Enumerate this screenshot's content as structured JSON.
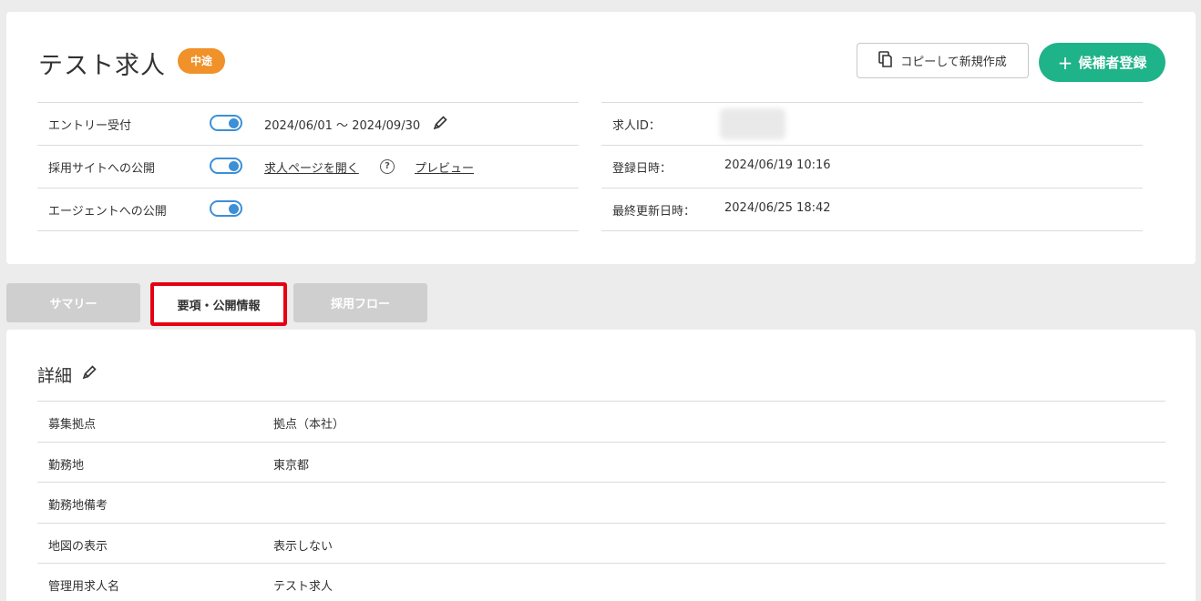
{
  "header": {
    "title": "テスト求人",
    "badge": "中途",
    "copy_button": "コピーして新規作成",
    "add_candidate_button": "候補者登録"
  },
  "status_left": [
    {
      "label": "エントリー受付",
      "toggle_on": true,
      "value": "2024/06/01 ～ 2024/09/30"
    },
    {
      "label": "採用サイトへの公開",
      "toggle_on": true,
      "link_open": "求人ページを開く",
      "help": "?",
      "link_preview": "プレビュー"
    },
    {
      "label": "エージェントへの公開",
      "toggle_on": true
    }
  ],
  "status_right": [
    {
      "label": "求人ID：",
      "value": ""
    },
    {
      "label": "登録日時：",
      "value": "2024/06/19 10:16"
    },
    {
      "label": "最終更新日時：",
      "value": "2024/06/25 18:42"
    }
  ],
  "tabs": [
    {
      "label": "サマリー",
      "active": false
    },
    {
      "label": "要項・公開情報",
      "active": true
    },
    {
      "label": "採用フロー",
      "active": false
    }
  ],
  "detail": {
    "title": "詳細",
    "rows": [
      {
        "label": "募集拠点",
        "value": "拠点（本社）"
      },
      {
        "label": "勤務地",
        "value": "東京都"
      },
      {
        "label": "勤務地備考",
        "value": ""
      },
      {
        "label": "地図の表示",
        "value": "表示しない"
      },
      {
        "label": "管理用求人名",
        "value": "テスト求人"
      }
    ]
  },
  "colors": {
    "accent_green": "#1fb389",
    "badge_orange": "#f0912a",
    "link_blue": "#3d8fd6",
    "highlight_red": "#e60012"
  },
  "icons": {
    "copy": "copy-icon",
    "plus": "plus-icon",
    "edit": "pencil-icon",
    "help": "question-icon"
  }
}
